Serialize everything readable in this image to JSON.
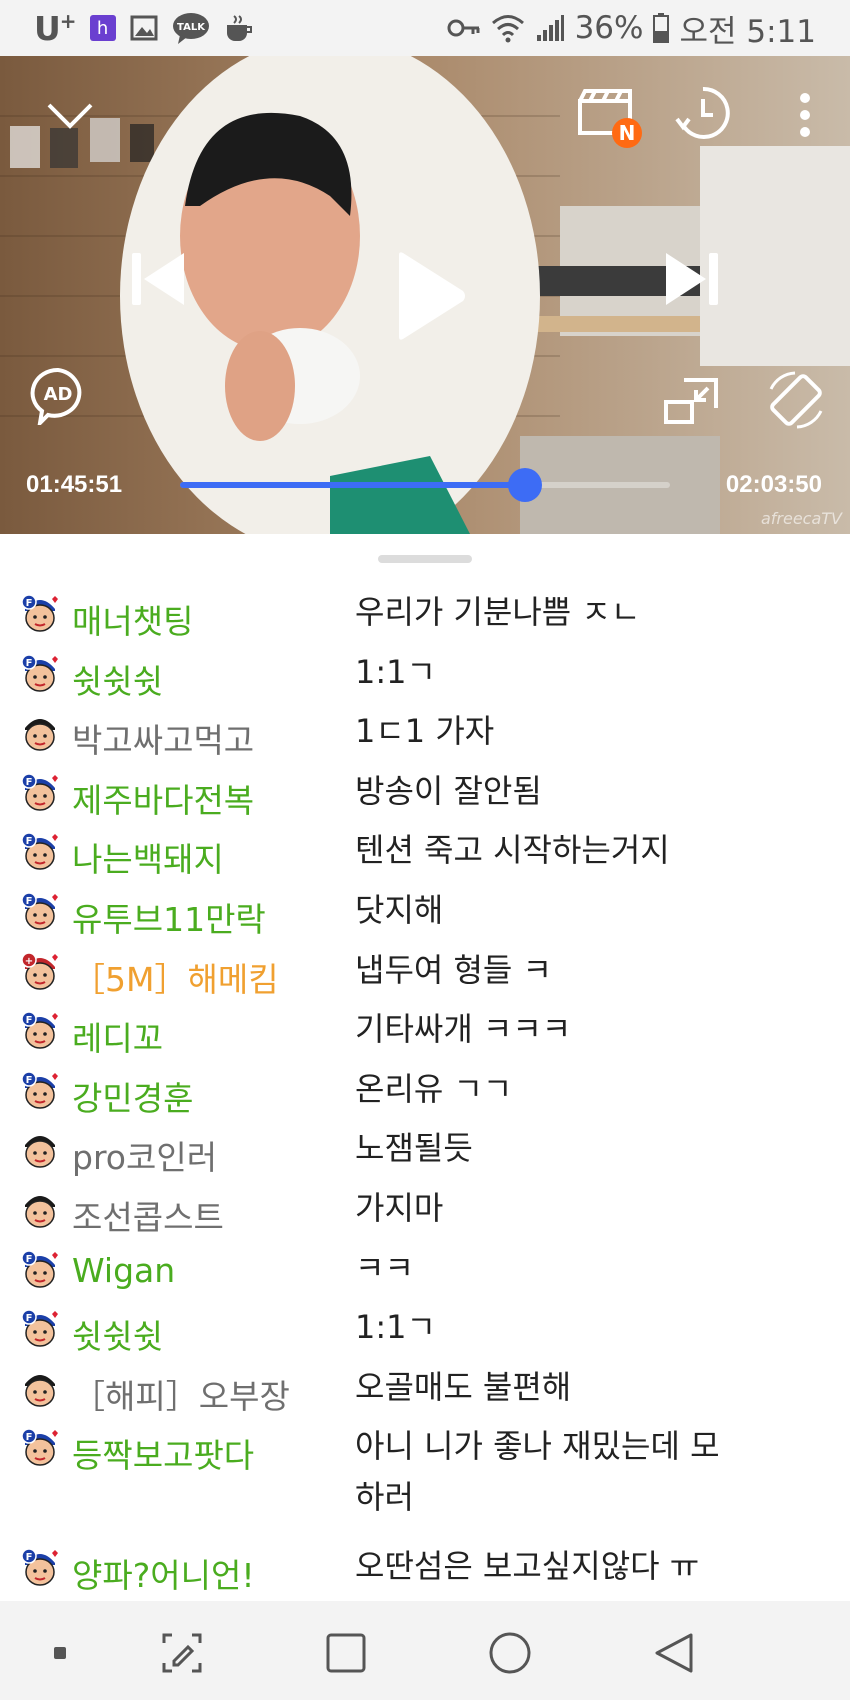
{
  "statusbar": {
    "carrier": "U",
    "carrier_plus": "+",
    "h_badge": "h",
    "talk_badge": "TALK",
    "battery": "36%",
    "time": "오전 5:11"
  },
  "player": {
    "badge_new": "N",
    "ad_label": "AD",
    "time_current": "01:45:51",
    "time_total": "02:03:50",
    "progress": 0.705,
    "watermark": "afreecaTV",
    "accent_color": "#3d6cf5"
  },
  "chat": [
    {
      "nick": "매너챗팅",
      "type": "fan",
      "badge": "F",
      "message": "우리가 기분나쁨 ㅈㄴ"
    },
    {
      "nick": "쉿쉿쉿",
      "type": "fan",
      "badge": "F",
      "message": "1:1ㄱ"
    },
    {
      "nick": "박고싸고먹고",
      "type": "plain",
      "badge": "",
      "message": "1ㄷ1 가자"
    },
    {
      "nick": "제주바다전복",
      "type": "fan",
      "badge": "F",
      "message": "방송이 잘안됨"
    },
    {
      "nick": "나는백돼지",
      "type": "fan",
      "badge": "F",
      "message": "텐션 죽고 시작하는거지"
    },
    {
      "nick": "유투브11만락",
      "type": "fan",
      "badge": "F",
      "message": "닷지해"
    },
    {
      "nick": "［5M］해메킴",
      "type": "sub",
      "badge": "+",
      "message": "냅두여 형들 ㅋ"
    },
    {
      "nick": "레디꼬",
      "type": "fan",
      "badge": "F",
      "message": "기타싸개 ㅋㅋㅋ"
    },
    {
      "nick": "강민경훈",
      "type": "fan",
      "badge": "F",
      "message": "온리유 ㄱㄱ"
    },
    {
      "nick": "pro코인러",
      "type": "plain",
      "badge": "",
      "message": "노잼될듯"
    },
    {
      "nick": "조선콥스트",
      "type": "plain",
      "badge": "",
      "message": "가지마"
    },
    {
      "nick": "Wigan",
      "type": "fan",
      "badge": "F",
      "message": "ㅋㅋ"
    },
    {
      "nick": "쉿쉿쉿",
      "type": "fan",
      "badge": "F",
      "message": "1:1ㄱ"
    },
    {
      "nick": "［해피］오부장",
      "type": "plain",
      "badge": "",
      "message": "오골매도 불편해"
    },
    {
      "nick": "등짝보고팟다",
      "type": "fan",
      "badge": "F",
      "message": "아니 니가 좋나 재밌는데 모하러"
    },
    {
      "nick": "양파?어니언!",
      "type": "fan",
      "badge": "F",
      "message": "오딴섬은 보고싶지않다 ㅠ"
    }
  ],
  "colors": {
    "fan_nick": "#4aac1f",
    "plain_nick": "#6f6f6f",
    "sub_nick": "#f0a030"
  }
}
